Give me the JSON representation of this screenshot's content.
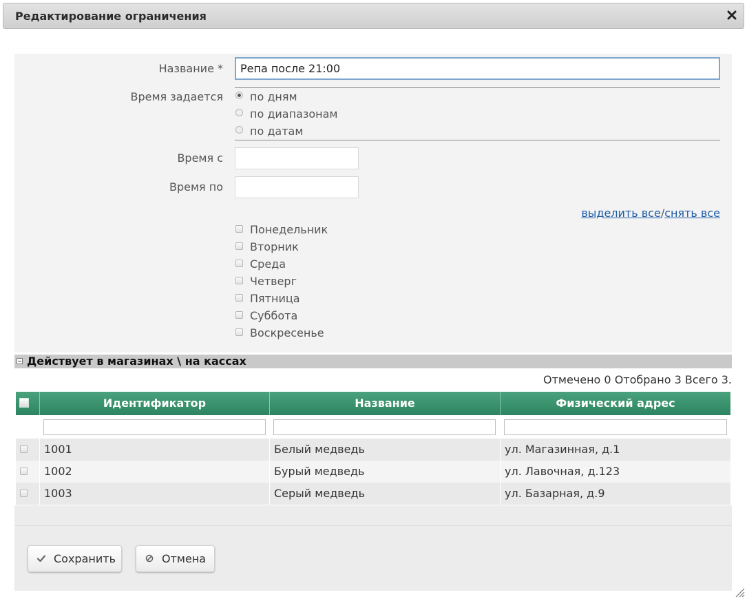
{
  "dialog": {
    "title": "Редактирование ограничения",
    "close_icon": "close-icon"
  },
  "form": {
    "name_label": "Название *",
    "name_value": "Репа после 21:00",
    "time_mode_label": "Время задается",
    "time_modes": [
      {
        "label": "по дням",
        "checked": true
      },
      {
        "label": "по диапазонам",
        "checked": false
      },
      {
        "label": "по датам",
        "checked": false
      }
    ],
    "time_from_label": "Время с",
    "time_from_value": "",
    "time_to_label": "Время по",
    "time_to_value": "",
    "select_all": "выделить все",
    "link_separator": "/",
    "deselect_all": "снять все",
    "days": [
      {
        "label": "Понедельник",
        "checked": false
      },
      {
        "label": "Вторник",
        "checked": false
      },
      {
        "label": "Среда",
        "checked": false
      },
      {
        "label": "Четверг",
        "checked": false
      },
      {
        "label": "Пятница",
        "checked": false
      },
      {
        "label": "Суббота",
        "checked": false
      },
      {
        "label": "Воскресенье",
        "checked": false
      }
    ]
  },
  "stores": {
    "section_title": "Действует в магазинах \\ на кассах",
    "summary": "Отмечено 0 Отобрано 3 Всего 3.",
    "columns": [
      "Идентификатор",
      "Название",
      "Физический адрес"
    ],
    "rows": [
      {
        "id": "1001",
        "name": "Белый медведь",
        "address": "ул. Магазинная, д.1",
        "checked": false
      },
      {
        "id": "1002",
        "name": "Бурый медведь",
        "address": "ул. Лавочная, д.123",
        "checked": false
      },
      {
        "id": "1003",
        "name": "Серый медведь",
        "address": "ул. Базарная, д.9",
        "checked": false
      }
    ]
  },
  "buttons": {
    "save": "Сохранить",
    "save_icon": "checkmark-icon",
    "cancel": "Отмена",
    "cancel_icon": "cancel-icon"
  },
  "colors": {
    "grid_header": "#3a9470",
    "link": "#1d5ba8",
    "focus_border": "#7fa6cf"
  }
}
